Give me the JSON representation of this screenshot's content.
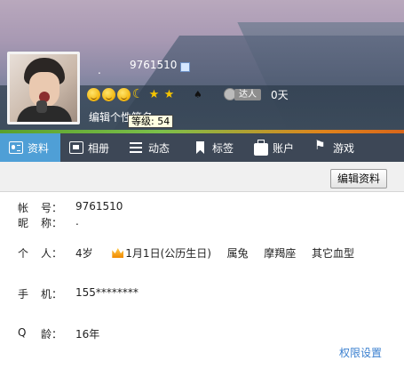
{
  "header": {
    "dot": ".",
    "qq_number": "9761510",
    "level_tooltip": "等级: 54",
    "talent_label": "达人",
    "days": "0天",
    "signature": "编辑个性签名"
  },
  "tabs": [
    {
      "label": "资料",
      "icon": "profile-card-icon",
      "active": true
    },
    {
      "label": "相册",
      "icon": "photo-icon"
    },
    {
      "label": "动态",
      "icon": "feed-list-icon"
    },
    {
      "label": "标签",
      "icon": "bookmark-icon"
    },
    {
      "label": "账户",
      "icon": "briefcase-icon"
    },
    {
      "label": "游戏",
      "icon": "game-icon"
    }
  ],
  "toolbar": {
    "edit_label": "编辑资料"
  },
  "profile": {
    "account_label": [
      "帐",
      "号："
    ],
    "account": "9761510",
    "nickname_label": [
      "昵",
      "称："
    ],
    "nickname": ".",
    "personal_label": [
      "个",
      "人："
    ],
    "age": "4岁",
    "birthday": "1月1日(公历生日)",
    "zodiac": "属兔",
    "constellation": "摩羯座",
    "blood": "其它血型",
    "phone_label": [
      "手",
      "机："
    ],
    "phone": "155********",
    "qage_label": [
      "Q",
      "龄："
    ],
    "qage": "16年"
  },
  "footer": {
    "permission_label": "权限设置"
  }
}
